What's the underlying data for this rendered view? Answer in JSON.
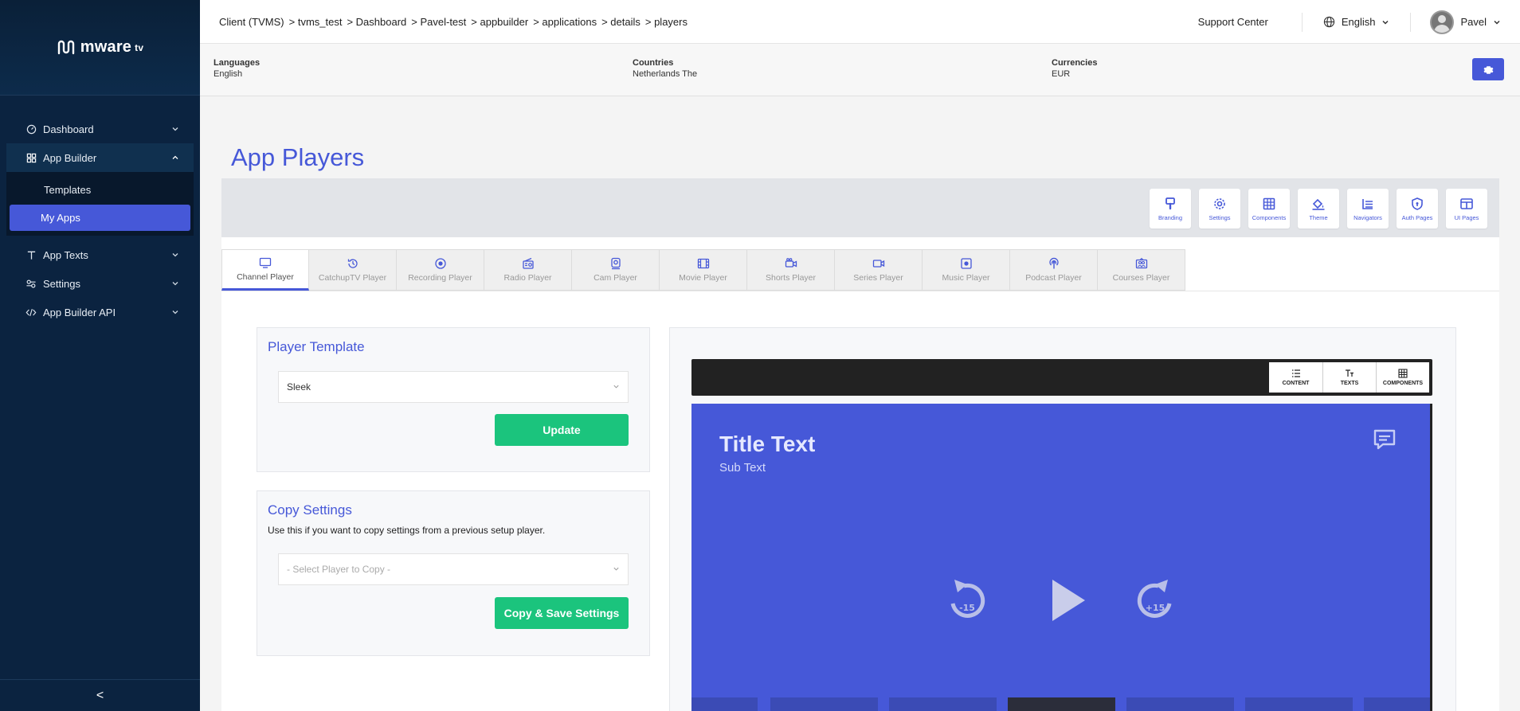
{
  "brand": {
    "name": "mware",
    "suffix": "tv"
  },
  "sidebar": {
    "items": [
      {
        "label": "Dashboard"
      },
      {
        "label": "App Builder"
      },
      {
        "label": "App Texts"
      },
      {
        "label": "Settings"
      },
      {
        "label": "App Builder API"
      }
    ],
    "app_builder_sub": [
      {
        "label": "Templates"
      },
      {
        "label": "My Apps"
      }
    ],
    "collapse_glyph": "<"
  },
  "topbar": {
    "breadcrumb": [
      "Client (TVMS)",
      "> tvms_test",
      "> Dashboard",
      "> Pavel-test",
      "> appbuilder",
      "> applications",
      "> details",
      "> players"
    ],
    "support": "Support Center",
    "language": "English",
    "user": "Pavel"
  },
  "infobar": {
    "languages_label": "Languages",
    "languages_value": "English",
    "countries_label": "Countries",
    "countries_value": "Netherlands The",
    "currencies_label": "Currencies",
    "currencies_value": "EUR"
  },
  "page": {
    "title": "App Players"
  },
  "toolbar": {
    "buttons": [
      {
        "label": "Branding",
        "icon": "brush-icon"
      },
      {
        "label": "Settings",
        "icon": "gear-icon"
      },
      {
        "label": "Components",
        "icon": "grid-icon"
      },
      {
        "label": "Theme",
        "icon": "paint-bucket-icon"
      },
      {
        "label": "Navigators",
        "icon": "list-icon"
      },
      {
        "label": "Auth Pages",
        "icon": "shield-icon"
      },
      {
        "label": "UI Pages",
        "icon": "layout-icon"
      }
    ]
  },
  "tabs": [
    {
      "label": "Channel Player",
      "icon": "tv-icon",
      "active": true
    },
    {
      "label": "CatchupTV Player",
      "icon": "history-icon"
    },
    {
      "label": "Recording Player",
      "icon": "record-icon"
    },
    {
      "label": "Radio Player",
      "icon": "radio-icon"
    },
    {
      "label": "Cam Player",
      "icon": "webcam-icon"
    },
    {
      "label": "Movie Player",
      "icon": "film-icon"
    },
    {
      "label": "Shorts Player",
      "icon": "video-camera-icon"
    },
    {
      "label": "Series Player",
      "icon": "video-icon"
    },
    {
      "label": "Music Player",
      "icon": "music-icon"
    },
    {
      "label": "Podcast Player",
      "icon": "podcast-icon"
    },
    {
      "label": "Courses Player",
      "icon": "courses-icon"
    }
  ],
  "player_template": {
    "title": "Player Template",
    "selected": "Sleek",
    "update_label": "Update"
  },
  "copy_settings": {
    "title": "Copy Settings",
    "hint": "Use this if you want to copy settings from a previous setup player.",
    "placeholder": "- Select Player to Copy -",
    "button_label": "Copy & Save Settings"
  },
  "preview": {
    "tools": [
      {
        "label": "CONTENT",
        "icon": "list-icon"
      },
      {
        "label": "TEXTS",
        "icon": "text-size-icon"
      },
      {
        "label": "COMPONENTS",
        "icon": "grid-icon"
      }
    ],
    "title": "Title Text",
    "subtitle": "Sub Text",
    "rewind_label": "-15",
    "forward_label": "+15"
  },
  "colors": {
    "accent": "#4658d8",
    "sidebar": "#0b2340",
    "success": "#1bc47d"
  }
}
